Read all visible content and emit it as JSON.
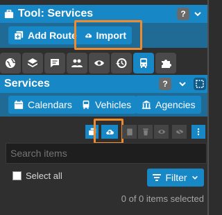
{
  "titlebar": {
    "title": "Tool: Services",
    "help": "?",
    "collapse_icon": "chevron-down-icon"
  },
  "toolbar": {
    "add_route_label": "Add Route",
    "import_label": "Import"
  },
  "tabs": [
    {
      "icon": "globe-icon"
    },
    {
      "icon": "layers-icon"
    },
    {
      "icon": "comment-icon"
    },
    {
      "icon": "users-icon"
    },
    {
      "icon": "eye-icon"
    },
    {
      "icon": "history-icon"
    },
    {
      "icon": "bus-icon",
      "active": true
    },
    {
      "icon": "puzzle-icon"
    }
  ],
  "services": {
    "title": "Services",
    "help": "?",
    "nav": {
      "calendars": "Calendars",
      "vehicles": "Vehicles",
      "agencies": "Agencies"
    }
  },
  "list": {
    "search_placeholder": "Search items",
    "select_all_label": "Select all",
    "filter_label": "Filter",
    "count_text": "0 of 0 items selected"
  },
  "colors": {
    "accent": "#1787c6",
    "highlight": "#f08a2c",
    "panel": "#2f2f2f"
  }
}
